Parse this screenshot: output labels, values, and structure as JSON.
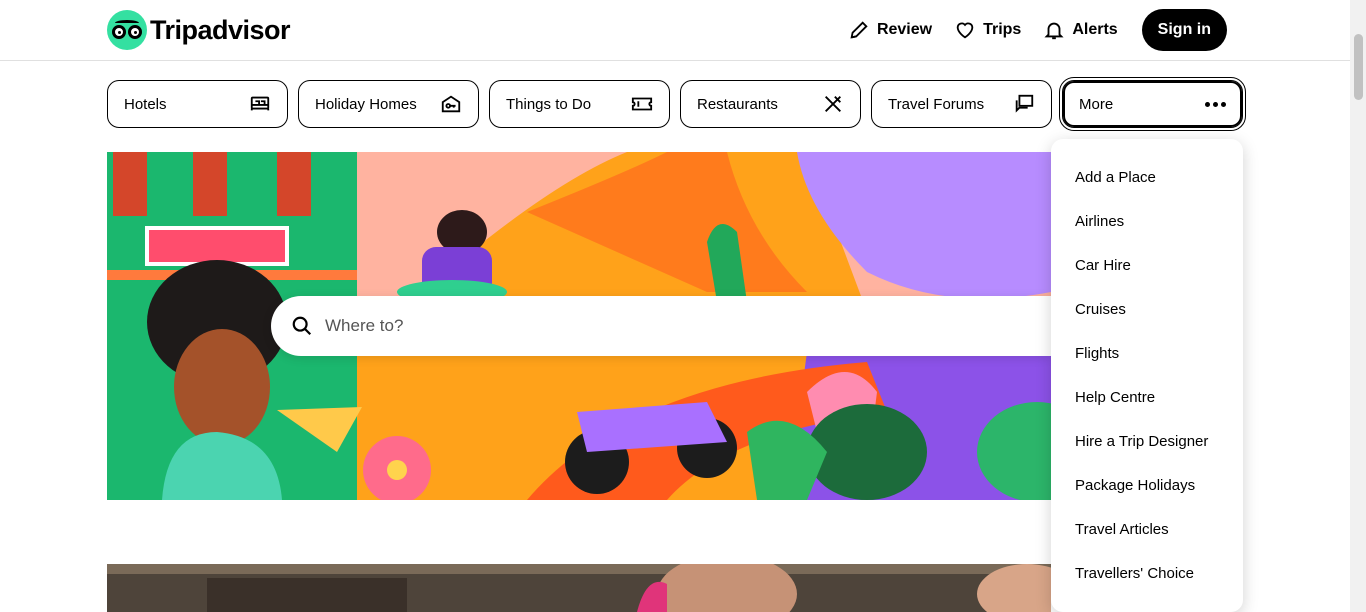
{
  "brand": {
    "name": "Tripadvisor",
    "accent": "#34e0a1"
  },
  "header": {
    "links": [
      {
        "label": "Review",
        "icon": "pencil-icon"
      },
      {
        "label": "Trips",
        "icon": "heart-icon"
      },
      {
        "label": "Alerts",
        "icon": "bell-icon"
      }
    ],
    "signin_label": "Sign in"
  },
  "tabs": [
    {
      "label": "Hotels",
      "icon": "bed-icon"
    },
    {
      "label": "Holiday Homes",
      "icon": "house-key-icon"
    },
    {
      "label": "Things to Do",
      "icon": "ticket-icon"
    },
    {
      "label": "Restaurants",
      "icon": "fork-knife-icon"
    },
    {
      "label": "Travel Forums",
      "icon": "chat-bubbles-icon"
    },
    {
      "label": "More",
      "icon": "more-dots-icon"
    }
  ],
  "search": {
    "placeholder": "Where to?"
  },
  "more_menu": {
    "items": [
      "Add a Place",
      "Airlines",
      "Car Hire",
      "Cruises",
      "Flights",
      "Help Centre",
      "Hire a Trip Designer",
      "Package Holidays",
      "Travel Articles",
      "Travellers' Choice"
    ]
  }
}
